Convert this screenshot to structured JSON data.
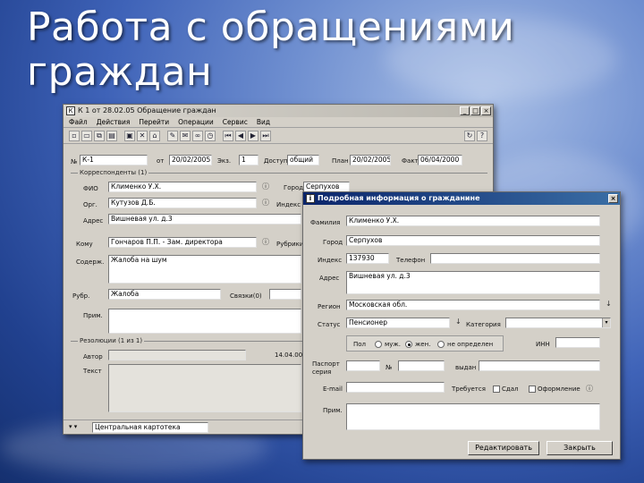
{
  "slide": {
    "title_line1": "Работа с обращениями",
    "title_line2": "граждан"
  },
  "main_window": {
    "title": "К 1 от 28.02.05 Обращение граждан",
    "controls": [
      "_",
      "□",
      "×"
    ],
    "menu": [
      "Файл",
      "Действия",
      "Перейти",
      "Операции",
      "Сервис",
      "Вид"
    ],
    "toolbar_icons": [
      "new-icon",
      "open-icon",
      "copy-icon",
      "print-icon",
      "save-icon",
      "delete-icon",
      "attach-icon",
      "edit-icon",
      "mail-icon",
      "link-icon",
      "history-icon",
      "sep",
      "first-icon",
      "prev-icon",
      "next-icon",
      "last-icon"
    ],
    "right_icons": [
      "refresh-icon",
      "help-icon"
    ],
    "header": {
      "number_label": "№",
      "number_value": "К-1",
      "date_label": "от",
      "date_value": "20/02/2005",
      "copies_label": "Экз.",
      "copies_value": "1",
      "access_label": "Доступ",
      "access_value": "общий",
      "plan_label": "План",
      "plan_value": "20/02/2005",
      "fact_label": "Факт",
      "fact_value": "06/04/2000"
    },
    "correspondent_group": "Корреспонденты (1)",
    "fio_label": "ФИО",
    "fio_value": "Клименко У.Х.",
    "city_label": "Город",
    "city_value": "Серпухов",
    "org_label": "Орг.",
    "org_value": "Кутузов Д.Б.",
    "index_label": "Индекс",
    "index_value": "",
    "address_label": "Адрес",
    "address_value": "Вишневая ул. д.3",
    "addressee_label": "Кому",
    "addressee_value": "Гончаров П.П. - Зам. директора",
    "rubric_label": "Рубрики",
    "rubric_value": "",
    "content_label": "Содерж.",
    "content_value": "Жалоба на шум",
    "rubric2_label": "Рубр.",
    "rubric2_value": "Жалоба",
    "links_label": "Связки(0)",
    "note_label": "Прим.",
    "resolution_group": "Резолюции (1 из 1)",
    "author_label": "Автор",
    "resolution_date": "14.04.00",
    "text_label": "Текст",
    "status_value": "Центральная картотека"
  },
  "detail_window": {
    "title": "Подробная информация о гражданине",
    "controls": [
      "×"
    ],
    "surname_label": "Фамилия",
    "surname_value": "Клименко У.Х.",
    "city_label": "Город",
    "city_value": "Серпухов",
    "index_label": "Индекс",
    "index_value": "137930",
    "phone_label": "Телефон",
    "phone_value": "",
    "address_label": "Адрес",
    "address_value": "Вишневая ул. д.3",
    "region_label": "Регион",
    "region_value": "Московская обл.",
    "status_label": "Статус",
    "status_value": "Пенсионер",
    "category_label": "Категория",
    "category_value": "",
    "sex_label": "Пол",
    "sex_options": [
      "муж.",
      "жен.",
      "не определен"
    ],
    "sex_selected": 1,
    "inn_label": "ИНН",
    "passport_label": "Паспорт серия",
    "passport_no_label": "№",
    "issued_label": "выдан",
    "email_label": "E-mail",
    "requires_label": "Требуется",
    "mail_label": "Сдал",
    "certify_label": "Оформление",
    "note_label": "Прим.",
    "edit_button": "Редактировать",
    "close_button": "Закрыть"
  },
  "colors": {
    "active_title": "#0a246a",
    "window_bg": "#d4d0c8"
  }
}
